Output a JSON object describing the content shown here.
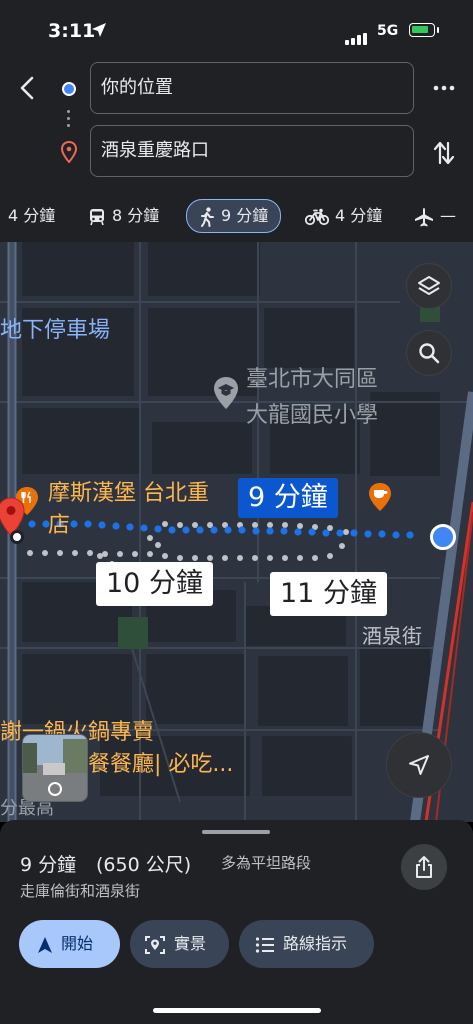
{
  "status_bar": {
    "time": "3:11",
    "network": "5G"
  },
  "directions": {
    "origin": "你的位置",
    "destination": "酒泉重慶路口"
  },
  "modes": [
    {
      "name": "drive",
      "label": "4 分鐘"
    },
    {
      "name": "transit",
      "label": "8 分鐘"
    },
    {
      "name": "walk",
      "label": "9 分鐘",
      "selected": true
    },
    {
      "name": "bike",
      "label": "4 分鐘"
    },
    {
      "name": "flight",
      "label": "—"
    }
  ],
  "map": {
    "labels": {
      "parking": "地下停車場",
      "school_line1": "臺北市大同區",
      "school_line2": "大龍國民小學",
      "restaurant_line1": "摩斯漢堡 台北重",
      "restaurant_line2": "店",
      "street": "酒泉街",
      "hotpot_line1": "謝一鍋火鍋專賣",
      "hotpot_line2": "餐餐廳| 必吃...",
      "cut_label": "分最高"
    },
    "route_tips": {
      "main": "9 分鐘",
      "alt1": "10 分鐘",
      "alt2": "11 分鐘"
    }
  },
  "summary": {
    "time": "9 分鐘",
    "distance": "(650 公尺)",
    "note": "多為平坦路段",
    "via": "走庫倫街和酒泉街"
  },
  "actions": {
    "start": "開始",
    "live_view": "實景",
    "steps": "路線指示"
  },
  "colors": {
    "accent": "#8ab4f8",
    "route": "#1a73e8",
    "map_bg": "#2e3440",
    "panel": "#202124"
  }
}
